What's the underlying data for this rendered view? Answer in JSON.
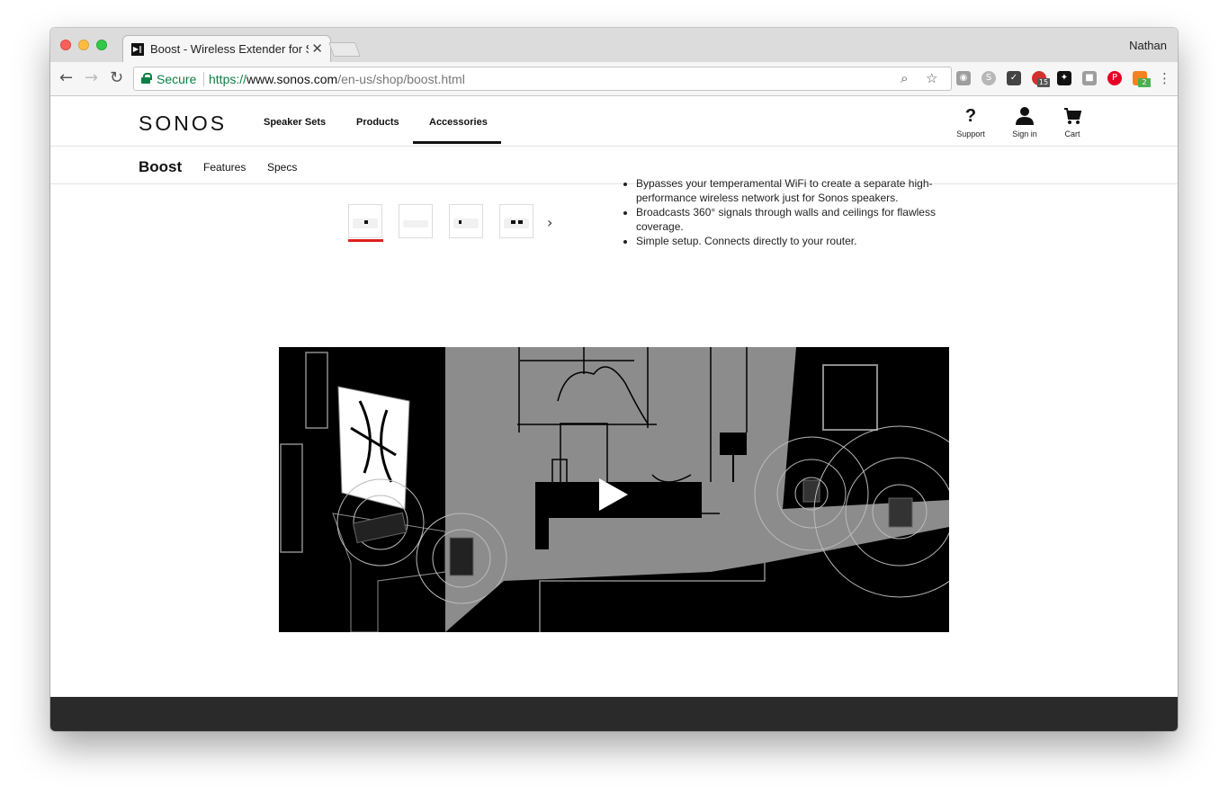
{
  "browser": {
    "tab_title": "Boost - Wireless Extender for Sonos",
    "tab_close": "✕",
    "profile_name": "Nathan",
    "secure_label": "Secure",
    "url_scheme": "https://",
    "url_host": "www.sonos.com",
    "url_path": "/en-us/shop/boost.html",
    "extension_badges": [
      "15",
      "2"
    ]
  },
  "site": {
    "logo": "SONOS",
    "nav": [
      "Speaker Sets",
      "Products",
      "Accessories"
    ],
    "utilities": [
      {
        "label": "Support",
        "icon": "?"
      },
      {
        "label": "Sign in",
        "icon": "person-icon"
      },
      {
        "label": "Cart",
        "icon": "cart-icon"
      }
    ]
  },
  "subnav": {
    "title": "Boost",
    "links": [
      "Features",
      "Specs"
    ]
  },
  "features": [
    "Bypasses your temperamental WiFi to create a separate high-performance wireless network just for Sonos speakers.",
    "Broadcasts 360° signals through walls and ceilings for flawless coverage.",
    "Simple setup. Connects directly to your router."
  ],
  "gallery": {
    "next_label": "›"
  }
}
